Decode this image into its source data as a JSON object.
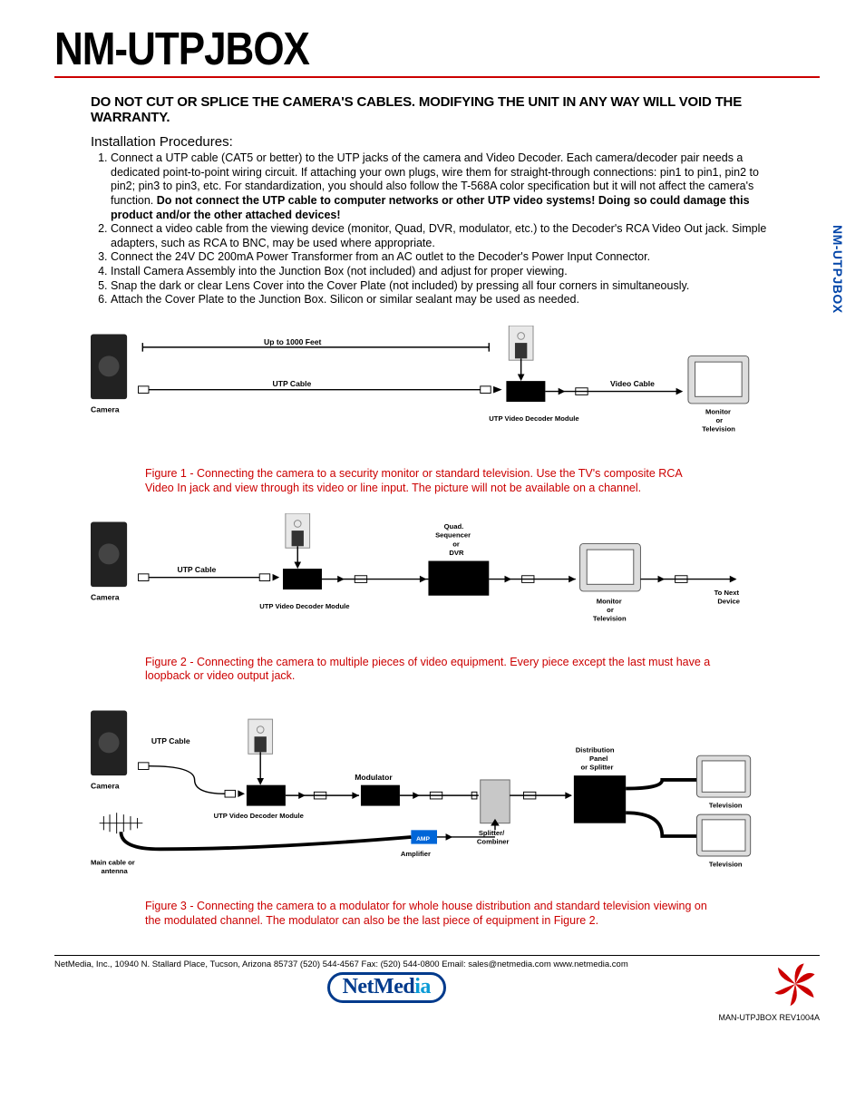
{
  "header": {
    "title": "NM-UTPJBOX",
    "side_tab": "NM-UTPJBOX"
  },
  "warning": "DO NOT CUT OR SPLICE THE CAMERA'S CABLES. MODIFYING THE UNIT IN ANY WAY WILL VOID THE WARRANTY.",
  "install_header": "Installation Procedures:",
  "steps": [
    {
      "pre": "Connect a UTP cable (CAT5 or better) to the UTP jacks of the camera and Video Decoder. Each camera/decoder pair needs a dedicated point-to-point wiring circuit. If attaching your own plugs, wire them for straight-through connections: pin1 to pin1, pin2 to pin2; pin3 to pin3, etc. For standardization, you should also follow the T-568A color specification but it will not affect the camera's function. ",
      "bold": "Do not connect the UTP cable to computer networks or other UTP video systems! Doing so could damage this product and/or the other attached devices!"
    },
    {
      "pre": "Connect a video cable from the viewing device (monitor, Quad, DVR, modulator, etc.) to the Decoder's RCA Video Out jack. Simple adapters, such as RCA to BNC, may be used where appropriate."
    },
    {
      "pre": "Connect the 24V DC 200mA Power Transformer from an AC outlet to the Decoder's Power Input Connector."
    },
    {
      "pre": "Install Camera Assembly into the Junction Box (not included) and adjust for proper viewing."
    },
    {
      "pre": "Snap the dark or clear Lens Cover into the Cover Plate (not included) by pressing all four corners in simultaneously."
    },
    {
      "pre": "Attach the Cover Plate to the Junction Box. Silicon or similar sealant may be used as needed."
    }
  ],
  "figures": {
    "f1": {
      "caption": "Figure 1 - Connecting the camera to a security monitor or standard television. Use the TV's composite RCA Video In jack and view through its video or line input. The picture will not be available on a channel.",
      "labels": {
        "camera": "Camera",
        "distance": "Up to 1000 Feet",
        "utp": "UTP Cable",
        "decoder": "UTP Video Decoder Module",
        "vcable": "Video Cable",
        "monitor": "Monitor\nor\nTelevision"
      }
    },
    "f2": {
      "caption": "Figure 2 - Connecting the camera to multiple pieces of video equipment. Every piece except the last must have a loopback or video output jack.",
      "labels": {
        "camera": "Camera",
        "utp": "UTP Cable",
        "decoder": "UTP Video Decoder Module",
        "quad": "Quad.\nSequencer\nor\nDVR",
        "monitor": "Monitor\nor\nTelevision",
        "next": "To Next\nDevice"
      }
    },
    "f3": {
      "caption": "Figure 3 - Connecting the camera to a modulator for whole house distribution and standard television viewing on the modulated channel. The modulator can also be the last piece of equipment in Figure 2.",
      "labels": {
        "camera": "Camera",
        "utp": "UTP Cable",
        "decoder": "UTP Video Decoder Module",
        "modulator": "Modulator",
        "amplifier": "Amplifier",
        "splitcomb": "Splitter/\nCombiner",
        "distpanel": "Distribution\nPanel\nor Splitter",
        "tv": "Television",
        "antenna": "Main cable or\nantenna"
      }
    }
  },
  "footer": {
    "address": "NetMedia, Inc., 10940 N. Stallard Place, Tucson, Arizona  85737 (520) 544-4567 Fax: (520) 544-0800 Email: sales@netmedia.com www.netmedia.com",
    "logo_text": "NetMedia",
    "rev": "MAN-UTPJBOX    REV1004A"
  }
}
